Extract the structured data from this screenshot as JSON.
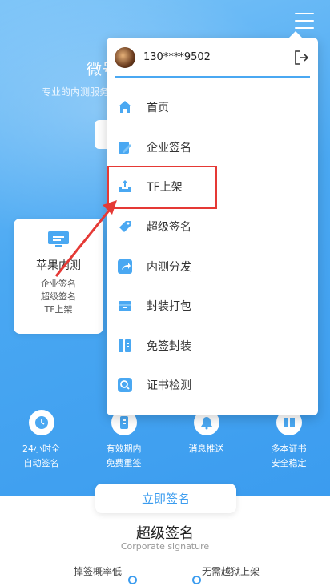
{
  "hero": {
    "title": "微号",
    "subtitle": "专业的内测服务"
  },
  "card": {
    "title": "苹果内测",
    "lines": [
      "企业签名",
      "超级签名",
      "TF上架"
    ]
  },
  "features": [
    {
      "icon": "clock-icon",
      "lines": [
        "24小时全",
        "自动签名"
      ]
    },
    {
      "icon": "doc-icon",
      "lines": [
        "有效期内",
        "免费重签"
      ]
    },
    {
      "icon": "bell-icon",
      "lines": [
        "消息推送",
        ""
      ]
    },
    {
      "icon": "book-icon",
      "lines": [
        "多本证书",
        "安全稳定"
      ]
    }
  ],
  "sign_button": "立即签名",
  "section": {
    "title": "超级签名",
    "subtitle": "Corporate signature",
    "points": [
      "掉签概率低",
      "无需越狱上架"
    ]
  },
  "menu": {
    "user_phone": "130****9502",
    "items": [
      {
        "label": "首页",
        "icon": "home-icon"
      },
      {
        "label": "企业签名",
        "icon": "edit-icon"
      },
      {
        "label": "TF上架",
        "icon": "upload-tray-icon"
      },
      {
        "label": "超级签名",
        "icon": "tag-icon"
      },
      {
        "label": "内测分发",
        "icon": "share-icon"
      },
      {
        "label": "封装打包",
        "icon": "box-icon"
      },
      {
        "label": "免签封装",
        "icon": "package-icon"
      },
      {
        "label": "证书检测",
        "icon": "search-certificate-icon"
      }
    ]
  },
  "colors": {
    "accent": "#3b9cef",
    "highlight": "#e53935"
  }
}
